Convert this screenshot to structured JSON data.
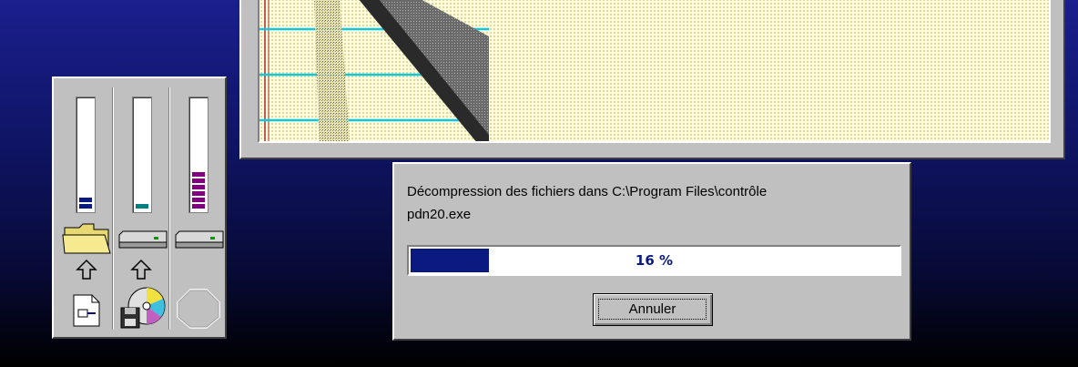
{
  "dialog": {
    "message_line1": "Décompression des fichiers dans C:\\Program Files\\contrôle",
    "message_line2": "pdn20.exe",
    "progress_percent": 16,
    "progress_text": "16 %",
    "cancel_label": "Annuler"
  },
  "meters": [
    {
      "name": "folder-destination",
      "level": 0.12,
      "color": "#0a1a80",
      "top_icon": "folder-icon",
      "bottom_icon": "document-icon"
    },
    {
      "name": "hard-drive",
      "level": 0.06,
      "color": "#008080",
      "top_icon": "hard-drive-icon",
      "bottom_icon": "cd-floppy-icon"
    },
    {
      "name": "disk-space",
      "level": 0.3,
      "color": "#800080",
      "top_icon": "hard-drive-icon",
      "bottom_icon": "octagon-icon"
    }
  ]
}
